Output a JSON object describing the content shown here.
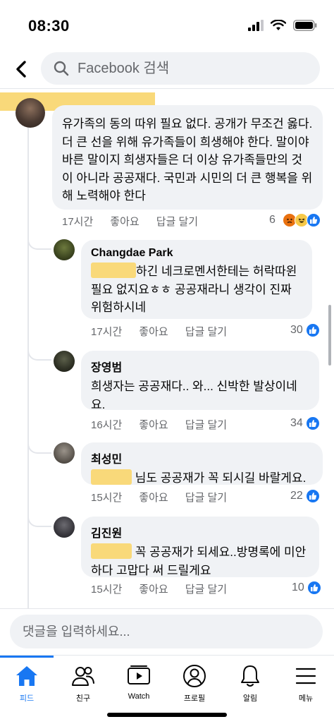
{
  "status_bar": {
    "time": "08:30"
  },
  "search": {
    "placeholder": "Facebook 검색"
  },
  "comments": [
    {
      "text": "유가족의 동의 따위 필요 없다. 공개가 무조건 옳다. 더 큰 선을 위해 유가족들이 희생해야 한다. 말이야 바른 말이지 희생자들은 더 이상 유가족들만의 것이 아니라 공공재다. 국민과 시민의 더 큰 행복을 위해 노력해야 한다",
      "time": "17시간",
      "like": "좋아요",
      "reply": "답글 달기",
      "reactions": "6"
    },
    {
      "author": "Changdae Park",
      "text": "하긴 네크로멘서한테는 허락따윈 필요 없지요ㅎㅎ 공공재라니 생각이 진짜 위험하시네",
      "time": "17시간",
      "like": "좋아요",
      "reply": "답글 달기",
      "reactions": "30"
    },
    {
      "author": "장영범",
      "text": "희생자는 공공재다.. 와... 신박한 발상이네요.",
      "time": "16시간",
      "like": "좋아요",
      "reply": "답글 달기",
      "reactions": "34"
    },
    {
      "author": "최성민",
      "text": "님도 공공재가 꼭 되시길 바랄게요.",
      "time": "15시간",
      "like": "좋아요",
      "reply": "답글 달기",
      "reactions": "22"
    },
    {
      "author": "김진원",
      "text": "꼭 공공재가 되세요..방명록에 미안하다 고맙다 써 드릴게요",
      "time": "15시간",
      "like": "좋아요",
      "reply": "답글 달기",
      "reactions": "10"
    }
  ],
  "composer": {
    "placeholder": "댓글을 입력하세요..."
  },
  "tabs": [
    {
      "label": "피드",
      "icon": "home-icon",
      "active": true
    },
    {
      "label": "친구",
      "icon": "friends-icon"
    },
    {
      "label": "Watch",
      "icon": "watch-icon"
    },
    {
      "label": "프로필",
      "icon": "profile-icon"
    },
    {
      "label": "알림",
      "icon": "bell-icon"
    },
    {
      "label": "메뉴",
      "icon": "menu-icon"
    }
  ],
  "colors": {
    "accent": "#1877f2",
    "bubble": "#f0f2f5",
    "redaction": "#f9d97a",
    "secondary_text": "#65676b"
  }
}
